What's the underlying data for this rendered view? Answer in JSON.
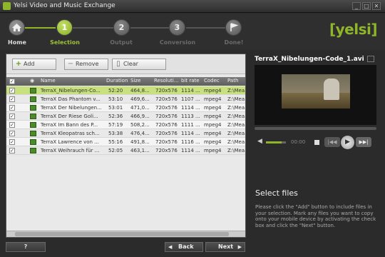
{
  "window": {
    "title": "Yelsi Video and Music Exchange",
    "min": "_",
    "max": "□",
    "close": "✕"
  },
  "wizard": {
    "steps": [
      {
        "number": "",
        "label": "Home"
      },
      {
        "number": "1",
        "label": "Selection"
      },
      {
        "number": "2",
        "label": "Output"
      },
      {
        "number": "3",
        "label": "Conversion"
      },
      {
        "number": "",
        "label": "Done!"
      }
    ],
    "logo": "[yelsi]"
  },
  "toolbar": {
    "add_label": "Add",
    "remove_label": "Remove",
    "clear_label": "Clear"
  },
  "table": {
    "headers": [
      "Name",
      "Duration",
      "Size",
      "Resoluti...",
      "bit rate",
      "Codec",
      "Path"
    ],
    "rows": [
      {
        "name": "TerraX_Nibelungen-Co...",
        "duration": "52:20",
        "size": "464,8...",
        "res": "720x576",
        "bitrate": "1114 ...",
        "codec": "mpeg4",
        "path": "Z:\\Mea..."
      },
      {
        "name": "TerraX Das Phantom v...",
        "duration": "53:10",
        "size": "469,6...",
        "res": "720x576",
        "bitrate": "1107 ...",
        "codec": "mpeg4",
        "path": "Z:\\Mea..."
      },
      {
        "name": "TerraX Der Nibelungen...",
        "duration": "53:01",
        "size": "471,0...",
        "res": "720x576",
        "bitrate": "1114 ...",
        "codec": "mpeg4",
        "path": "Z:\\Mea..."
      },
      {
        "name": "TerraX Der Riese Goli...",
        "duration": "52:36",
        "size": "466,9...",
        "res": "720x576",
        "bitrate": "1113 ...",
        "codec": "mpeg4",
        "path": "Z:\\Mea..."
      },
      {
        "name": "TerraX Im Bann des P...",
        "duration": "57:19",
        "size": "508,2...",
        "res": "720x576",
        "bitrate": "1111 ...",
        "codec": "mpeg4",
        "path": "Z:\\Mea..."
      },
      {
        "name": "TerraX Kleopatras sch...",
        "duration": "53:38",
        "size": "476,4...",
        "res": "720x576",
        "bitrate": "1114 ...",
        "codec": "mpeg4",
        "path": "Z:\\Mea..."
      },
      {
        "name": "TerraX Lawrence von ...",
        "duration": "55:16",
        "size": "491,8...",
        "res": "720x576",
        "bitrate": "1116 ...",
        "codec": "mpeg4",
        "path": "Z:\\Mea..."
      },
      {
        "name": "TerraX Weihrauch für ...",
        "duration": "52:05",
        "size": "463,1...",
        "res": "720x576",
        "bitrate": "1114 ...",
        "codec": "mpeg4",
        "path": "Z:\\Mea..."
      }
    ]
  },
  "player": {
    "file_title": "TerraX_Nibelungen-Code_1.avi",
    "time": "00:00"
  },
  "info": {
    "title": "Select files",
    "text": "Please click the \"Add\" button to include files in your selection. Mark any files you want to copy onto your mobile device by activating the check box and click the \"Next\" button."
  },
  "footer": {
    "help_label": "?",
    "back_label": "Back",
    "next_label": "Next"
  },
  "colors": {
    "accent": "#8fb629",
    "background": "#2b2b2b",
    "selected_row": "#c8e07d"
  }
}
